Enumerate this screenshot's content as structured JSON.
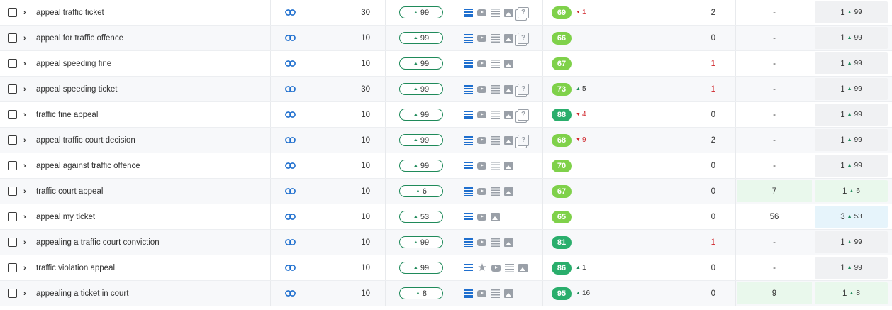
{
  "colors": {
    "kd_light": "#7fd14a",
    "kd_dark": "#2aae6c",
    "positive": "#1f8a5a",
    "negative": "#d0262b",
    "serp_feature_active": "#1f6fce",
    "serp_feature_inactive": "#9aa0a8",
    "highlight_green": "#e9f8ec",
    "highlight_blue": "#e6f4fb"
  },
  "rows": [
    {
      "keyword": "appeal traffic ticket",
      "volume": "30",
      "pill": "99",
      "features": [
        "lines",
        "video",
        "list",
        "image",
        "paa"
      ],
      "kd": "69",
      "kd_tone": "light",
      "kd_delta": "1",
      "kd_dir": "down",
      "count": "2",
      "count_red": false,
      "results": "-",
      "results_hl": false,
      "pos": "1",
      "pos_change": "99",
      "pos_hl": "none"
    },
    {
      "keyword": "appeal for traffic offence",
      "volume": "10",
      "pill": "99",
      "features": [
        "lines",
        "video",
        "list",
        "image",
        "paa"
      ],
      "kd": "66",
      "kd_tone": "light",
      "kd_delta": "",
      "kd_dir": "",
      "count": "0",
      "count_red": false,
      "results": "-",
      "results_hl": false,
      "pos": "1",
      "pos_change": "99",
      "pos_hl": "none"
    },
    {
      "keyword": "appeal speeding fine",
      "volume": "10",
      "pill": "99",
      "features": [
        "lines",
        "video",
        "list",
        "image"
      ],
      "kd": "67",
      "kd_tone": "light",
      "kd_delta": "",
      "kd_dir": "",
      "count": "1",
      "count_red": true,
      "results": "-",
      "results_hl": false,
      "pos": "1",
      "pos_change": "99",
      "pos_hl": "none"
    },
    {
      "keyword": "appeal speeding ticket",
      "volume": "30",
      "pill": "99",
      "features": [
        "lines",
        "video",
        "list",
        "image",
        "paa"
      ],
      "kd": "73",
      "kd_tone": "light",
      "kd_delta": "5",
      "kd_dir": "up",
      "count": "1",
      "count_red": true,
      "results": "-",
      "results_hl": false,
      "pos": "1",
      "pos_change": "99",
      "pos_hl": "none"
    },
    {
      "keyword": "traffic fine appeal",
      "volume": "10",
      "pill": "99",
      "features": [
        "lines",
        "video",
        "list",
        "image",
        "paa"
      ],
      "kd": "88",
      "kd_tone": "dark",
      "kd_delta": "4",
      "kd_dir": "down",
      "count": "0",
      "count_red": false,
      "results": "-",
      "results_hl": false,
      "pos": "1",
      "pos_change": "99",
      "pos_hl": "none"
    },
    {
      "keyword": "appeal traffic court decision",
      "volume": "10",
      "pill": "99",
      "features": [
        "lines",
        "video",
        "list",
        "image",
        "paa"
      ],
      "kd": "68",
      "kd_tone": "light",
      "kd_delta": "9",
      "kd_dir": "down",
      "count": "2",
      "count_red": false,
      "results": "-",
      "results_hl": false,
      "pos": "1",
      "pos_change": "99",
      "pos_hl": "none"
    },
    {
      "keyword": "appeal against traffic offence",
      "volume": "10",
      "pill": "99",
      "features": [
        "lines",
        "video",
        "list",
        "image"
      ],
      "kd": "70",
      "kd_tone": "light",
      "kd_delta": "",
      "kd_dir": "",
      "count": "0",
      "count_red": false,
      "results": "-",
      "results_hl": false,
      "pos": "1",
      "pos_change": "99",
      "pos_hl": "none"
    },
    {
      "keyword": "traffic court appeal",
      "volume": "10",
      "pill": "6",
      "features": [
        "lines",
        "video",
        "list",
        "image"
      ],
      "kd": "67",
      "kd_tone": "light",
      "kd_delta": "",
      "kd_dir": "",
      "count": "0",
      "count_red": false,
      "results": "7",
      "results_hl": true,
      "pos": "1",
      "pos_change": "6",
      "pos_hl": "green"
    },
    {
      "keyword": "appeal my ticket",
      "volume": "10",
      "pill": "53",
      "features": [
        "lines",
        "video",
        "image"
      ],
      "kd": "65",
      "kd_tone": "light",
      "kd_delta": "",
      "kd_dir": "",
      "count": "0",
      "count_red": false,
      "results": "56",
      "results_hl": false,
      "pos": "3",
      "pos_change": "53",
      "pos_hl": "blue"
    },
    {
      "keyword": "appealing a traffic court conviction",
      "volume": "10",
      "pill": "99",
      "features": [
        "lines",
        "video",
        "list",
        "image"
      ],
      "kd": "81",
      "kd_tone": "dark",
      "kd_delta": "",
      "kd_dir": "",
      "count": "1",
      "count_red": true,
      "results": "-",
      "results_hl": false,
      "pos": "1",
      "pos_change": "99",
      "pos_hl": "none"
    },
    {
      "keyword": "traffic violation appeal",
      "volume": "10",
      "pill": "99",
      "features": [
        "lines",
        "star",
        "video",
        "list",
        "image"
      ],
      "kd": "86",
      "kd_tone": "dark",
      "kd_delta": "1",
      "kd_dir": "up",
      "count": "0",
      "count_red": false,
      "results": "-",
      "results_hl": false,
      "pos": "1",
      "pos_change": "99",
      "pos_hl": "none"
    },
    {
      "keyword": "appealing a ticket in court",
      "volume": "10",
      "pill": "8",
      "features": [
        "lines",
        "video",
        "list",
        "image"
      ],
      "kd": "95",
      "kd_tone": "dark",
      "kd_delta": "16",
      "kd_dir": "up",
      "count": "0",
      "count_red": false,
      "results": "9",
      "results_hl": true,
      "pos": "1",
      "pos_change": "8",
      "pos_hl": "green"
    }
  ]
}
